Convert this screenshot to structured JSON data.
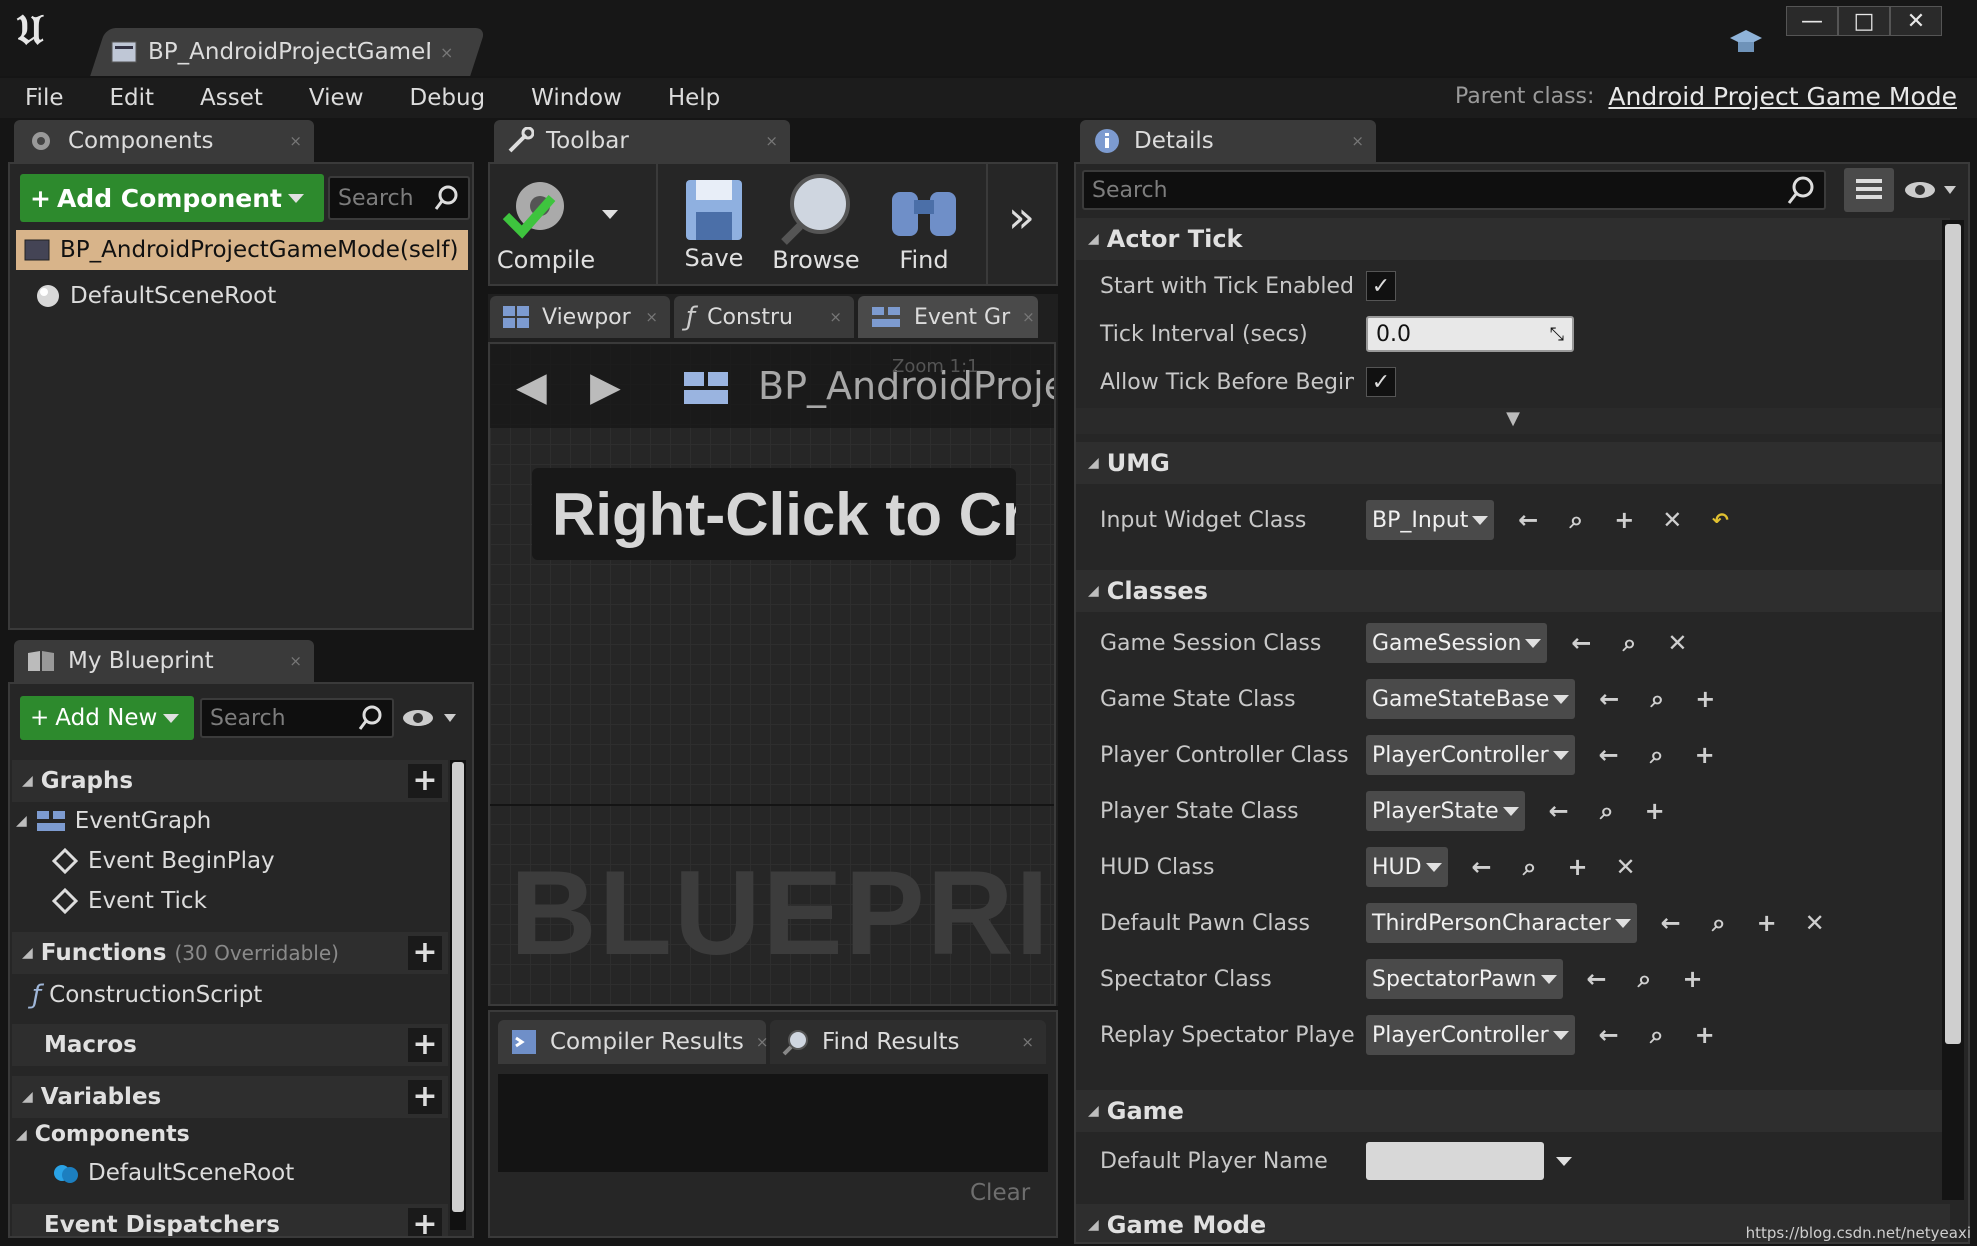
{
  "window": {
    "doc_tab": "BP_AndroidProjectGameMode",
    "tab_close": "×",
    "min": "—",
    "max": "□",
    "close": "✕"
  },
  "menu": [
    "File",
    "Edit",
    "Asset",
    "View",
    "Debug",
    "Window",
    "Help"
  ],
  "parent_class": {
    "label": "Parent class:",
    "value": "Android Project Game Mode"
  },
  "components": {
    "tab": "Components",
    "add_button": "Add Component",
    "search_placeholder": "Search",
    "self_item": "BP_AndroidProjectGameMode(self)",
    "root_item": "DefaultSceneRoot"
  },
  "my_blueprint": {
    "tab": "My Blueprint",
    "add_button": "Add New",
    "search_placeholder": "Search",
    "graphs": "Graphs",
    "event_graph": "EventGraph",
    "event_begin": "Event BeginPlay",
    "event_tick": "Event Tick",
    "functions": "Functions",
    "functions_sub": "(30 Overridable)",
    "construction": "ConstructionScript",
    "macros": "Macros",
    "variables": "Variables",
    "components": "Components",
    "default_root": "DefaultSceneRoot",
    "dispatchers": "Event Dispatchers"
  },
  "toolbar": {
    "tab": "Toolbar",
    "compile": "Compile",
    "save": "Save",
    "browse": "Browse",
    "find": "Find",
    "more": "»"
  },
  "graph": {
    "tab_viewport": "Viewpor",
    "tab_construct": "Constru",
    "tab_event": "Event Gr",
    "breadcrumb": "BP_AndroidProjec",
    "zoom": "Zoom 1:1",
    "hint": "Right-Click to Cre",
    "watermark": "BLUEPRIN"
  },
  "results": {
    "tab_compiler": "Compiler Results",
    "tab_find": "Find Results",
    "clear": "Clear"
  },
  "details": {
    "tab": "Details",
    "search_placeholder": "Search",
    "actor_tick": "Actor Tick",
    "start_tick": "Start with Tick Enabled",
    "tick_interval": "Tick Interval (secs)",
    "tick_interval_value": "0.0",
    "allow_tick": "Allow Tick Before Begin Play",
    "umg": "UMG",
    "input_widget": "Input Widget Class",
    "input_widget_value": "BP_Input",
    "classes": "Classes",
    "game_session": "Game Session Class",
    "game_session_value": "GameSession",
    "game_state": "Game State Class",
    "game_state_value": "GameStateBase",
    "player_controller": "Player Controller Class",
    "player_controller_value": "PlayerController",
    "player_state": "Player State Class",
    "player_state_value": "PlayerState",
    "hud": "HUD Class",
    "hud_value": "HUD",
    "default_pawn": "Default Pawn Class",
    "default_pawn_value": "ThirdPersonCharacter",
    "spectator": "Spectator Class",
    "spectator_value": "SpectatorPawn",
    "replay": "Replay Spectator Player Controller",
    "replay_value": "PlayerController",
    "game": "Game",
    "default_player_name": "Default Player Name",
    "game_mode": "Game Mode"
  },
  "watermark_url": "https://blog.csdn.net/netyeaxi",
  "colors": {
    "accent_green": "#2d8a2d",
    "selected_row": "#d8b48a",
    "bg": "#151515"
  }
}
